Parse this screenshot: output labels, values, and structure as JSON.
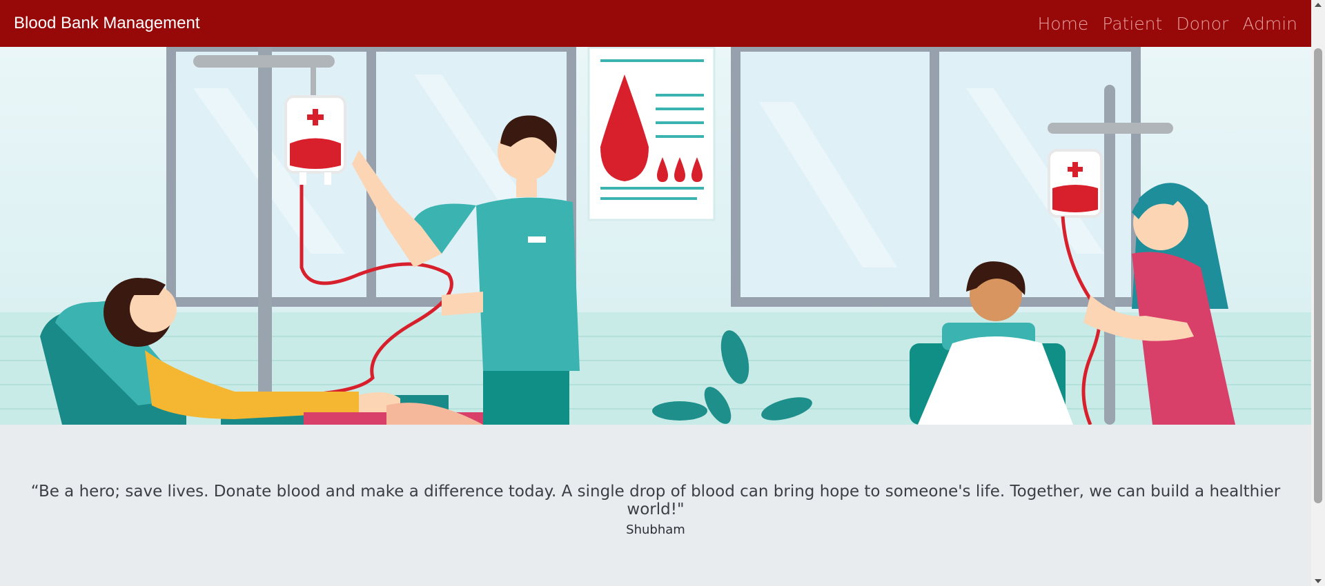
{
  "navbar": {
    "brand": "Blood Bank Management",
    "links": [
      "Home",
      "Patient",
      "Donor",
      "Admin"
    ]
  },
  "hero": {
    "illustration": "blood-donation-scene"
  },
  "quote": {
    "text": "“Be a hero; save lives. Donate blood and make a difference today. A single drop of blood can bring hope to someone's life. Together, we can build a healthier world!\"",
    "author": "Shubham"
  },
  "colors": {
    "navbar_bg": "#970808",
    "nav_link": "#e8a0a0",
    "page_bg": "#e8ecef",
    "accent_teal": "#3bb3b0",
    "blood_red": "#d8202c"
  }
}
